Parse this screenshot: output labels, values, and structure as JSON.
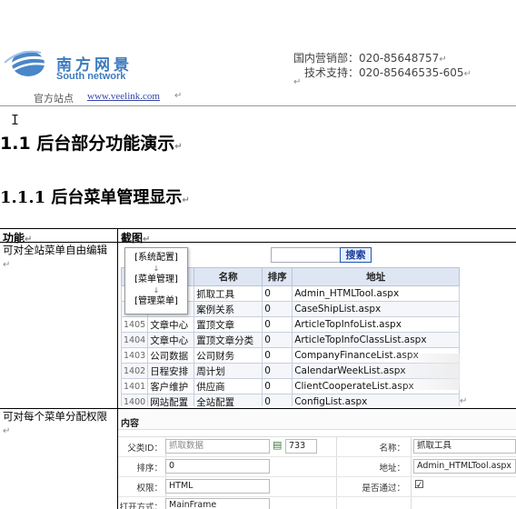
{
  "header": {
    "logo_cn": "南方网景",
    "logo_en": "South network",
    "sales_line": "国内营销部：020-85648757",
    "support_line": "技术支持：020-85646535-605",
    "site_label": "官方站点",
    "site_url": "www.veelink.com",
    "para_mark": "↵"
  },
  "headings": {
    "h1": "1.1  后台部分功能演示",
    "h2": "1.1.1 后台菜单管理显示"
  },
  "table": {
    "col_function": "功能",
    "col_screenshot": "截图",
    "rows": [
      {
        "function": "可对全站菜单自由编辑"
      },
      {
        "function": "可对每个菜单分配权限"
      }
    ]
  },
  "shot1": {
    "search_button": "搜索",
    "popup_items": [
      "[系统配置]",
      "[菜单管理]",
      "[管理菜单]"
    ],
    "columns": [
      "",
      "",
      "名称",
      "排序",
      "地址"
    ],
    "rows": [
      {
        "id": "",
        "module": "",
        "name": "抓取工具",
        "sort": "0",
        "url": "Admin_HTMLTool.aspx"
      },
      {
        "id": "",
        "module": "",
        "name": "案例关系",
        "sort": "0",
        "url": "CaseShipList.aspx"
      },
      {
        "id": "1405",
        "module": "文章中心",
        "name": "置顶文章",
        "sort": "0",
        "url": "ArticleTopInfoList.aspx"
      },
      {
        "id": "1404",
        "module": "文章中心",
        "name": "置顶文章分类",
        "sort": "0",
        "url": "ArticleTopInfoClassList.aspx"
      },
      {
        "id": "1403",
        "module": "公司数据",
        "name": "公司财务",
        "sort": "0",
        "url": "CompanyFinanceList.aspx"
      },
      {
        "id": "1402",
        "module": "日程安排",
        "name": "周计划",
        "sort": "0",
        "url": "CalendarWeekList.aspx"
      },
      {
        "id": "1401",
        "module": "客户维护",
        "name": "供应商",
        "sort": "0",
        "url": "ClientCooperateList.aspx"
      },
      {
        "id": "1400",
        "module": "网站配置",
        "name": "全站配置",
        "sort": "0",
        "url": "ConfigList.aspx"
      }
    ]
  },
  "shot2": {
    "title": "内容",
    "parent_label": "父类ID：",
    "parent_value": "抓取数据",
    "parent_id": "733",
    "name_label": "名称：",
    "name_value": "抓取工具",
    "sort_label": "排序：",
    "sort_value": "0",
    "url_label": "地址：",
    "url_value": "Admin_HTMLTool.aspx",
    "perm_label": "权限：",
    "perm_value": "HTML",
    "pass_label": "是否通过：",
    "pass_checked": "☑",
    "open_label": "打开方式：",
    "open_value": "MainFrame"
  }
}
